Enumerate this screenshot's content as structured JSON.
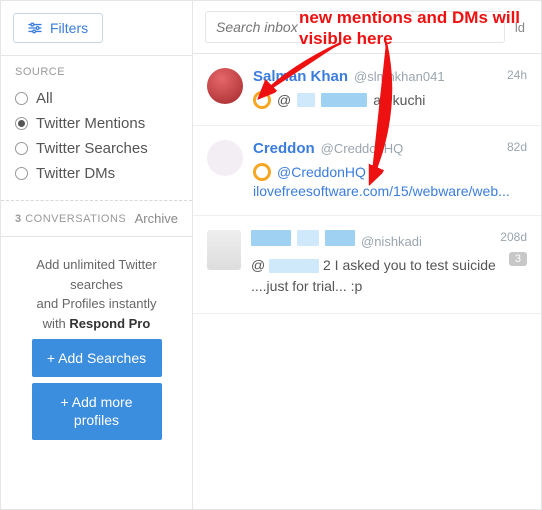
{
  "filtersLabel": "Filters",
  "source": {
    "title": "SOURCE",
    "options": [
      "All",
      "Twitter Mentions",
      "Twitter Searches",
      "Twitter DMs"
    ],
    "selectedIndex": 1
  },
  "convHeader": {
    "count": "3",
    "label": "CONVERSATIONS",
    "archive": "Archive"
  },
  "promo": {
    "line1": "Add unlimited Twitter searches",
    "line2": "and Profiles instantly",
    "line3pre": "with ",
    "line3bold": "Respond Pro",
    "btn1": "+ Add Searches",
    "btn2": "+ Add more profiles"
  },
  "search": {
    "placeholder": "Search inbox",
    "oldLabel": "ld"
  },
  "items": [
    {
      "name": "Salman Khan",
      "handle": "@slmnkhan041",
      "time": "24h",
      "mentionPrefix": "@",
      "tail": "aa kuchi"
    },
    {
      "name": "Creddon",
      "handle": "@CreddonHQ",
      "time": "82d",
      "mentionFull": "@CreddonHQ",
      "linkText": "ilovefreesoftware.com/15/webware/web..."
    },
    {
      "handle": "@nishkadi",
      "time": "208d",
      "badge": "3",
      "mentionPrefix": "@",
      "tail": "2 I asked you to test suicide ....just for trial... :p"
    }
  ],
  "annotation": "new mentions and DMs will visible here"
}
